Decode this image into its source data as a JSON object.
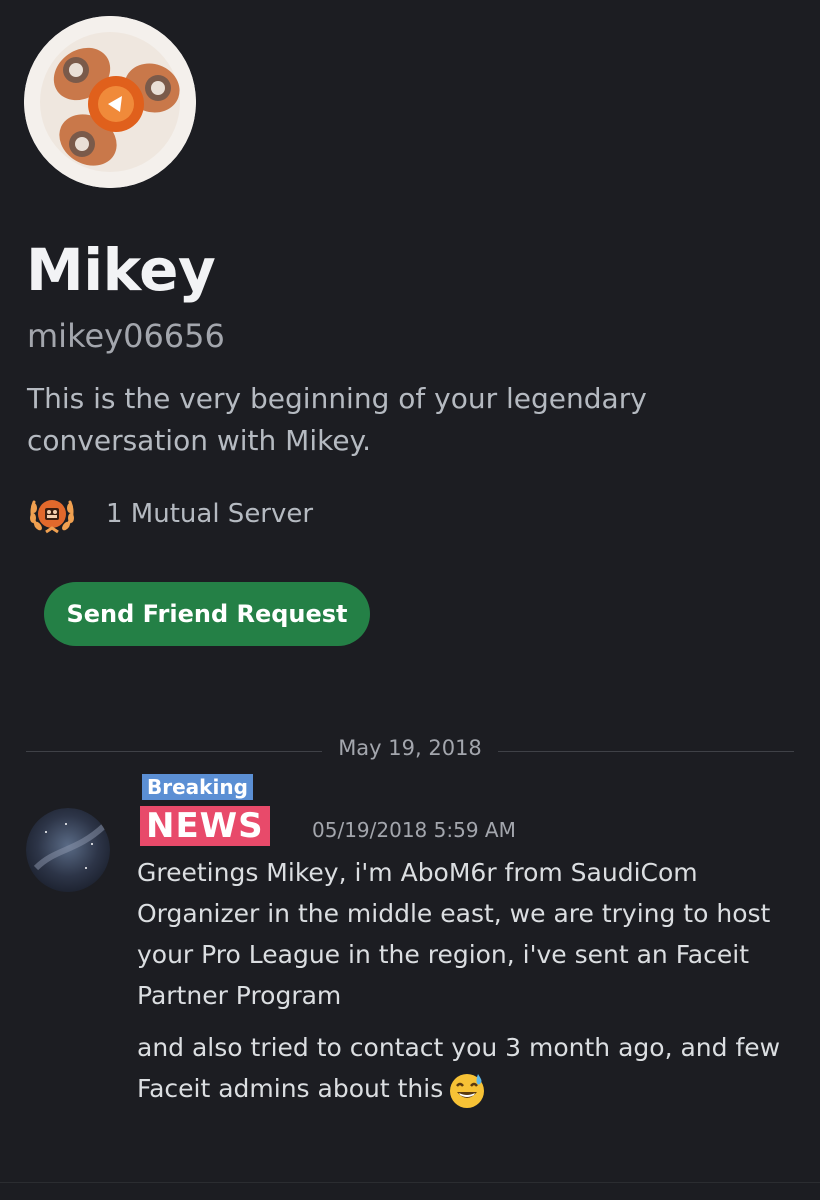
{
  "profile": {
    "display_name": "Mikey",
    "username": "mikey06656",
    "intro_text": "This is the very beginning of your legendary conversation with Mikey.",
    "avatar_icon": "fidget-spinner-avatar"
  },
  "mutual": {
    "icon": "server-laurel-icon",
    "label": "1 Mutual Server"
  },
  "actions": {
    "send_friend_request": "Send Friend Request"
  },
  "divider": {
    "date": "May 19, 2018"
  },
  "message": {
    "author_badge_top": "Breaking",
    "author_badge_bottom": "NEWS",
    "timestamp": "05/19/2018 5:59 AM",
    "line1": "Greetings Mikey, i'm AboM6r from SaudiCom Organizer in the middle east, we are trying to host your Pro League in the region, i've sent an Faceit Partner Program",
    "line2": "and also tried to contact you 3 month ago, and few Faceit admins about this",
    "emoji": "sweat-smile-emoji"
  },
  "colors": {
    "background": "#1c1d22",
    "button_green": "#248046",
    "muted_text": "#a3a6ad"
  }
}
